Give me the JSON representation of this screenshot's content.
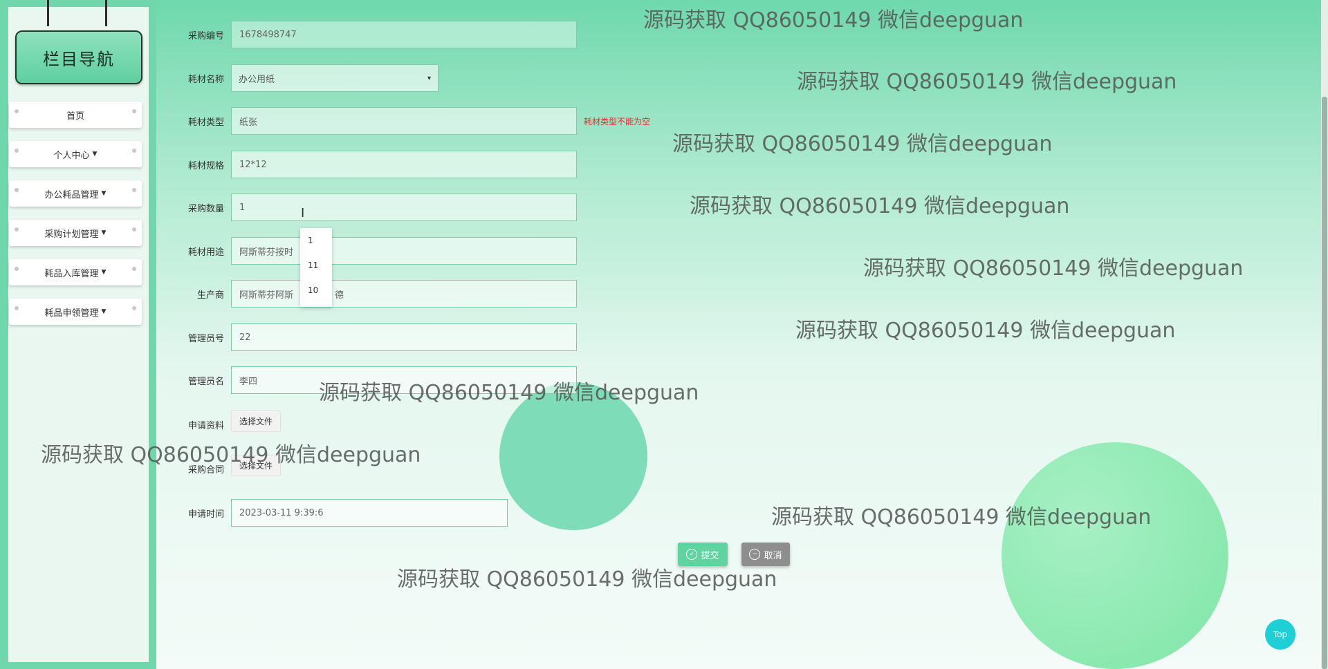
{
  "sidebar": {
    "title": "栏目导航",
    "items": [
      {
        "label": "首页",
        "dropdown": false
      },
      {
        "label": "个人中心",
        "dropdown": true
      },
      {
        "label": "办公耗品管理",
        "dropdown": true
      },
      {
        "label": "采购计划管理",
        "dropdown": true
      },
      {
        "label": "耗品入库管理",
        "dropdown": true
      },
      {
        "label": "耗品申领管理",
        "dropdown": true
      }
    ]
  },
  "form": {
    "purchase_no": {
      "label": "采购编号",
      "value": "1678498747"
    },
    "material_name": {
      "label": "耗材名称",
      "value": "办公用纸"
    },
    "material_type": {
      "label": "耗材类型",
      "value": "纸张",
      "error": "耗材类型不能为空"
    },
    "material_spec": {
      "label": "耗材规格",
      "value": "12*12"
    },
    "purchase_qty": {
      "label": "采购数量",
      "value": "1"
    },
    "material_use": {
      "label": "耗材用途",
      "value": "阿斯蒂芬按时"
    },
    "manufacturer": {
      "label": "生产商",
      "value": "阿斯蒂芬阿斯",
      "value_tail": "德"
    },
    "admin_no": {
      "label": "管理员号",
      "value": "22"
    },
    "admin_name": {
      "label": "管理员名",
      "value": "李四"
    },
    "application_doc": {
      "label": "申请资料",
      "button": "选择文件"
    },
    "purchase_contract": {
      "label": "采购合同",
      "button": "选择文件"
    },
    "apply_time": {
      "label": "申请时间",
      "value": "2023-03-11 9:39:6"
    },
    "autocomplete": [
      "1",
      "11",
      "10"
    ],
    "submit": "提交",
    "cancel": "取消"
  },
  "watermark": "源码获取 QQ86050149 微信deepguan",
  "top_button": "Top",
  "colors": {
    "accent": "#6fd7ab",
    "error": "#e52b2b",
    "submit": "#5fd4a0",
    "cancel": "#8e8e8e",
    "top": "#1ecfd6"
  }
}
